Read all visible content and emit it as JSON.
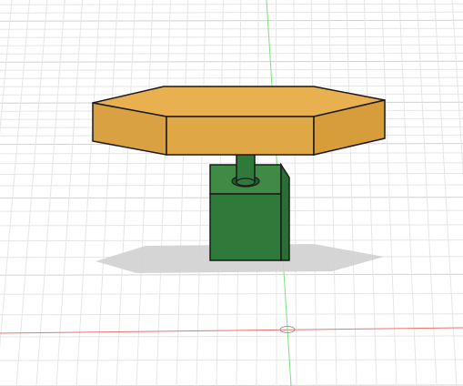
{
  "viewport": {
    "background_color": "#ffffff",
    "grid_minor_color": "#e6e6e6",
    "grid_major_color": "#d2d2d2",
    "x_axis_color": "#f07070",
    "y_axis_color": "#7ee07e"
  },
  "model": {
    "top_plate": {
      "shape": "hexagonal-prism",
      "color": "#e8b04f",
      "dark_color": "#d69d3a",
      "side_color": "#e0a845"
    },
    "shaft": {
      "shape": "cylinder",
      "color": "#2f7a3a"
    },
    "base_block": {
      "shape": "cube",
      "color": "#2f7a3a",
      "side_color": "#3f8a45"
    },
    "outline_color": "#1a1a1a",
    "shadow_color": "#d0d0d0"
  },
  "origin_marker": {
    "icon": "origin-ellipse-icon"
  }
}
